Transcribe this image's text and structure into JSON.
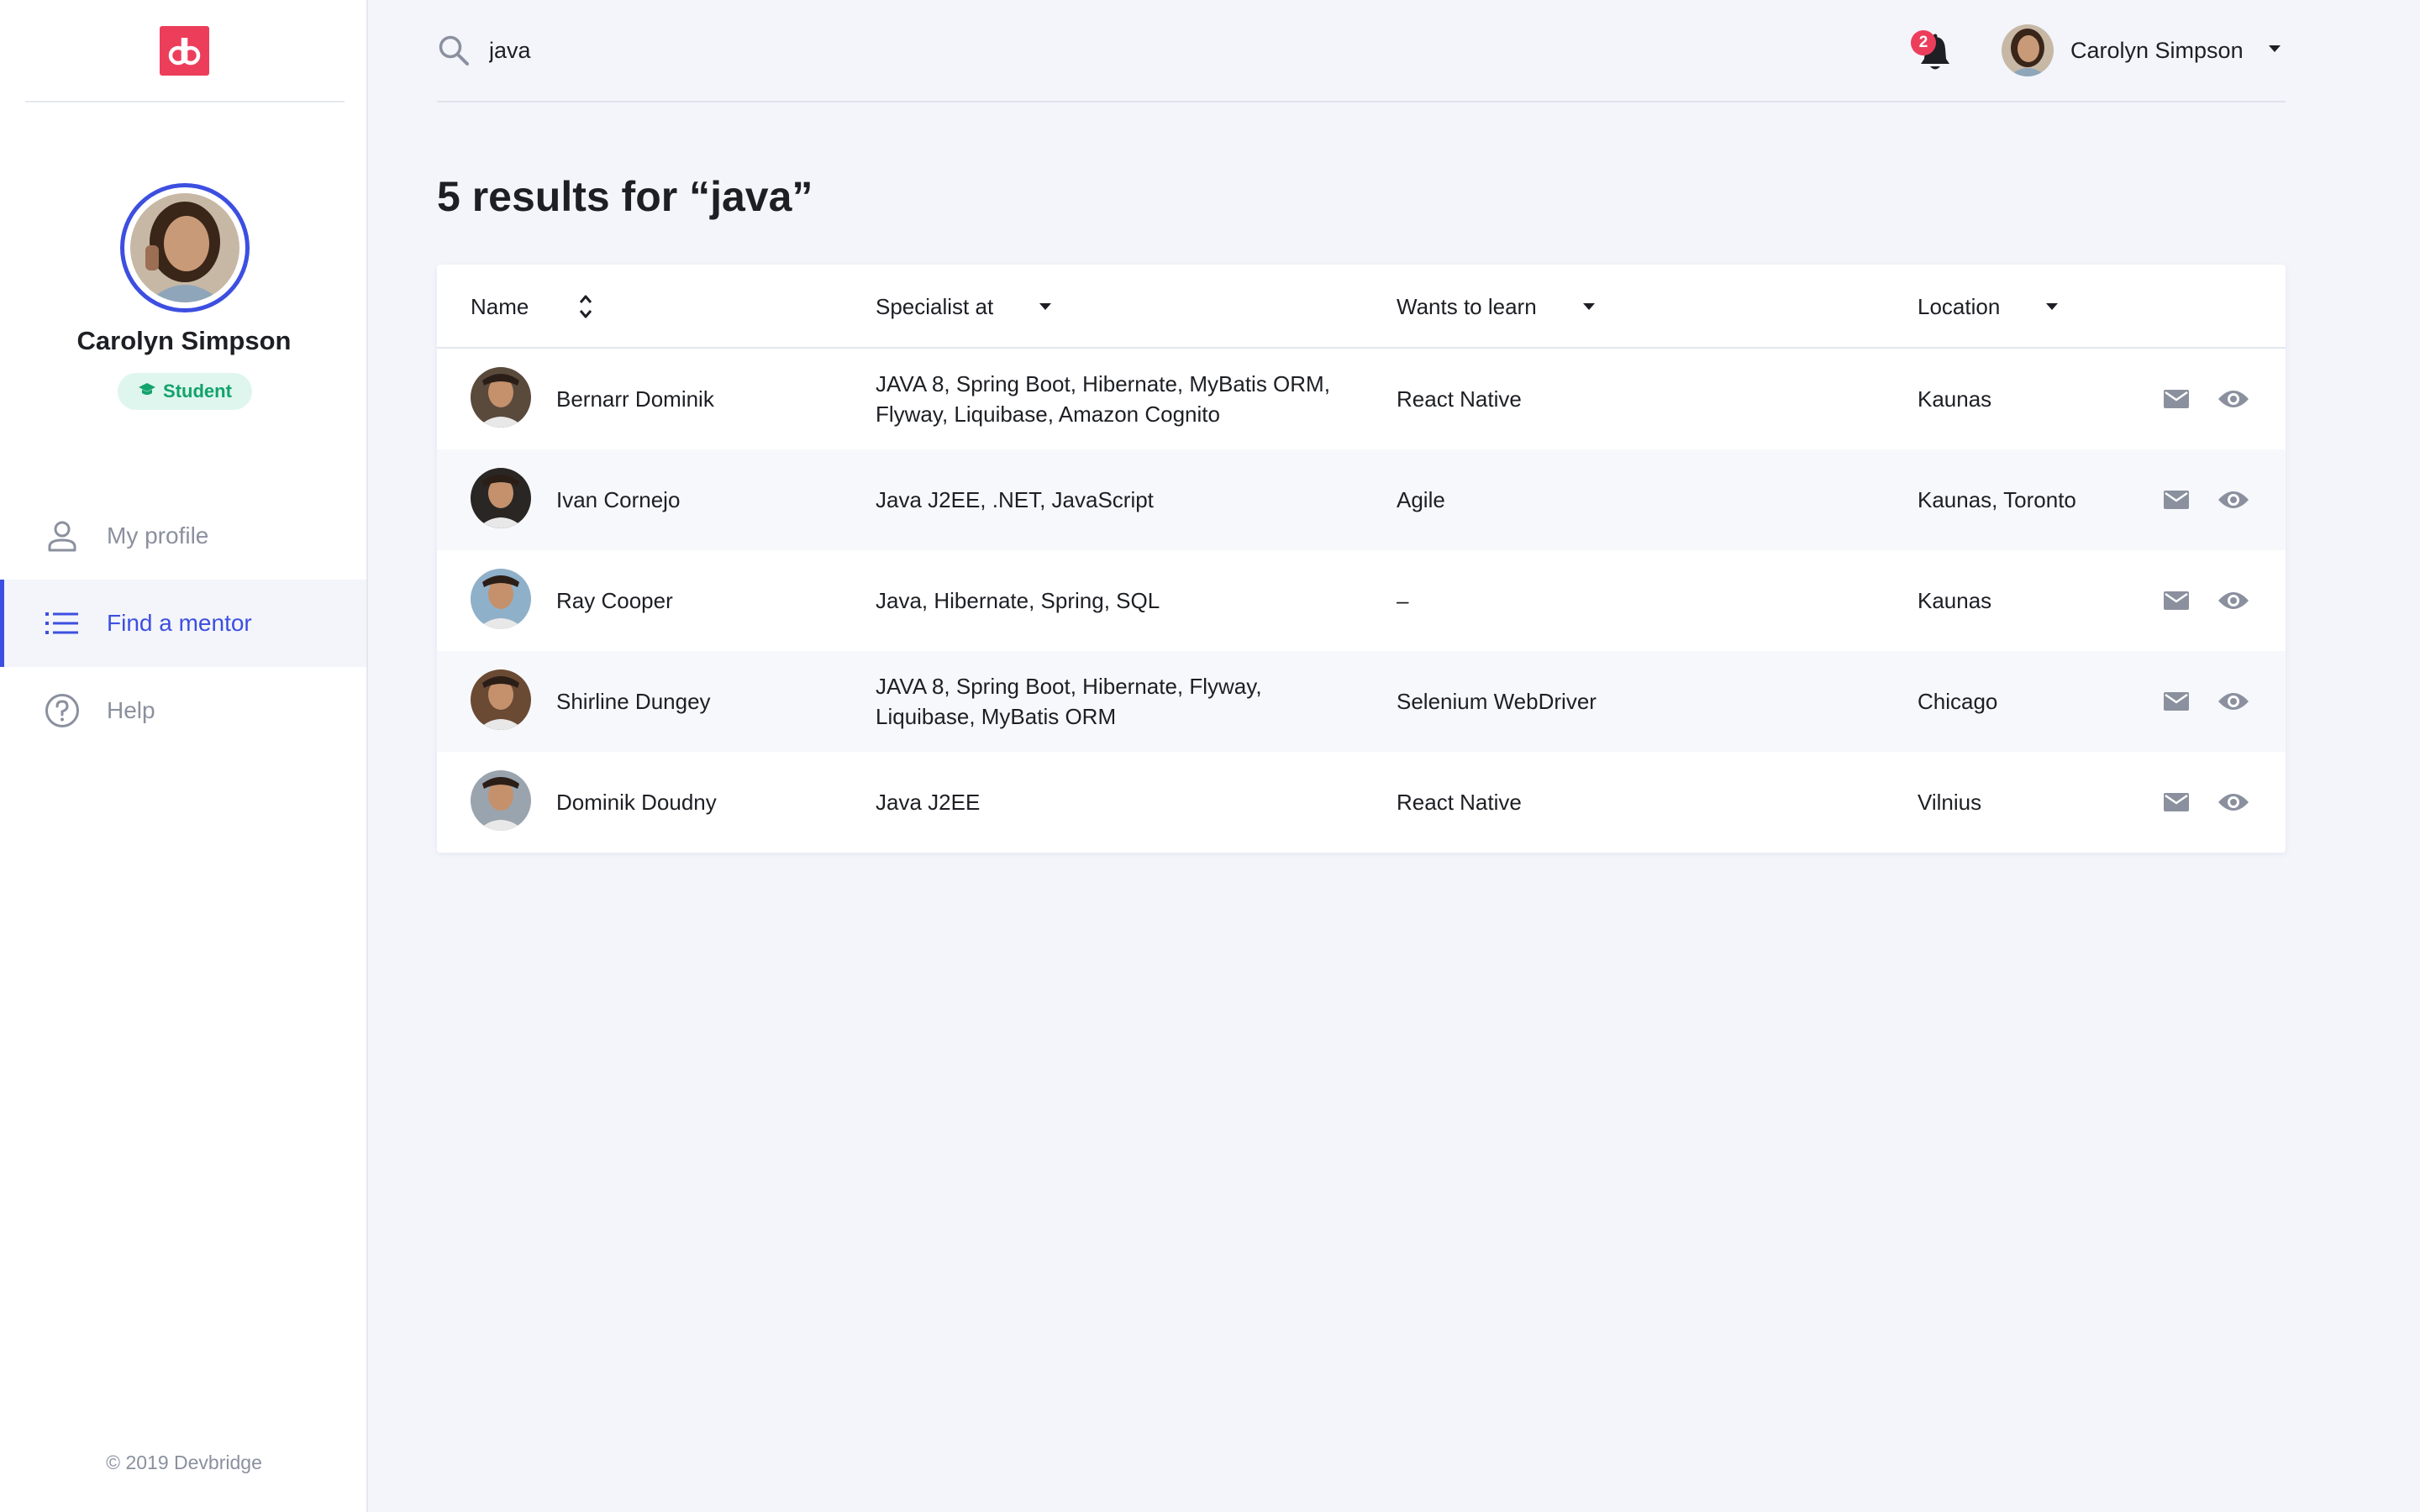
{
  "brand": {
    "logo_text": "db",
    "accent": "#3d4fe0",
    "logo_color": "#ec3e5b"
  },
  "sidebar": {
    "user_name": "Carolyn Simpson",
    "role": "Student",
    "nav": [
      {
        "label": "My profile",
        "icon": "person-icon",
        "active": false
      },
      {
        "label": "Find a mentor",
        "icon": "list-icon",
        "active": true
      },
      {
        "label": "Help",
        "icon": "help-circle-icon",
        "active": false
      }
    ],
    "copyright": "© 2019 Devbridge"
  },
  "topbar": {
    "search_value": "java",
    "notification_count": "2",
    "user_name": "Carolyn Simpson"
  },
  "main": {
    "title": "5 results for “java”",
    "columns": [
      {
        "label": "Name",
        "control": "sort"
      },
      {
        "label": "Specialist at",
        "control": "dropdown"
      },
      {
        "label": "Wants to learn",
        "control": "dropdown"
      },
      {
        "label": "Location",
        "control": "dropdown"
      }
    ],
    "rows": [
      {
        "name": "Bernarr Dominik",
        "specialist_line1": "JAVA 8, Spring Boot, Hibernate, MyBatis ORM,",
        "specialist_line2": "Flyway, Liquibase, Amazon Cognito",
        "wants": "React Native",
        "location": "Kaunas",
        "avatar_bg": "#5a4a3c"
      },
      {
        "name": "Ivan Cornejo",
        "specialist_line1": "Java J2EE, .NET, JavaScript",
        "specialist_line2": "",
        "wants": "Agile",
        "location": "Kaunas, Toronto",
        "avatar_bg": "#2a2624"
      },
      {
        "name": "Ray Cooper",
        "specialist_line1": "Java, Hibernate, Spring, SQL",
        "specialist_line2": "",
        "wants": "–",
        "location": "Kaunas",
        "avatar_bg": "#8fb0c9"
      },
      {
        "name": "Shirline Dungey",
        "specialist_line1": "JAVA 8, Spring Boot, Hibernate, Flyway,",
        "specialist_line2": "Liquibase, MyBatis ORM",
        "wants": "Selenium WebDriver",
        "location": "Chicago",
        "avatar_bg": "#6b4a34"
      },
      {
        "name": "Dominik Doudny",
        "specialist_line1": "Java J2EE",
        "specialist_line2": "",
        "wants": "React Native",
        "location": "Vilnius",
        "avatar_bg": "#9aa4ae"
      }
    ]
  }
}
